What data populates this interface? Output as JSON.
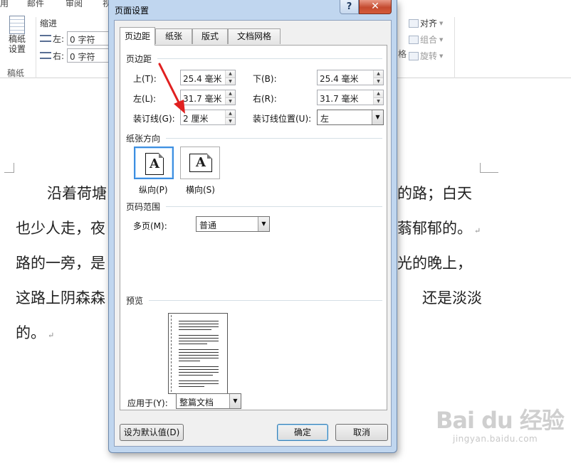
{
  "word": {
    "ribbon_tabs": [
      "用",
      "邮件",
      "审阅",
      "视"
    ],
    "paper_group": {
      "button_label_line1": "稿纸",
      "button_label_line2": "设置",
      "group_name": "稿纸"
    },
    "indent": {
      "title": "缩进",
      "left_label": "左:",
      "left_value": "0 字符",
      "right_label": "右:",
      "right_value": "0 字符"
    },
    "arrange": {
      "align": "对齐",
      "group": "组合",
      "rotate": "旋转",
      "fragment": "格"
    },
    "document_lines": [
      "沿着荷塘",
      "的路；白天",
      "也少人走，夜",
      "蓊郁郁的。",
      "路的一旁，是",
      "光的晚上，",
      "这路上阴森森",
      "还是淡淡",
      "的。"
    ],
    "paragraph_mark": "↵"
  },
  "watermark": {
    "logo": "Bai du 经验",
    "url": "jingyan.baidu.com"
  },
  "dialog": {
    "title": "页面设置",
    "help_label": "?",
    "close_label": "✕",
    "tabs": [
      {
        "label": "页边距",
        "active": true
      },
      {
        "label": "纸张",
        "active": false
      },
      {
        "label": "版式",
        "active": false
      },
      {
        "label": "文档网格",
        "active": false
      }
    ],
    "margins": {
      "group_title": "页边距",
      "top_label": "上(T):",
      "top_value": "25.4 毫米",
      "bottom_label": "下(B):",
      "bottom_value": "25.4 毫米",
      "left_label": "左(L):",
      "left_value": "31.7 毫米",
      "right_label": "右(R):",
      "right_value": "31.7 毫米",
      "gutter_label": "装订线(G):",
      "gutter_value": "2 厘米",
      "gutter_pos_label": "装订线位置(U):",
      "gutter_pos_value": "左"
    },
    "orientation": {
      "group_title": "纸张方向",
      "portrait_label": "纵向(P)",
      "landscape_label": "横向(S)",
      "glyph": "A",
      "selected": "portrait"
    },
    "pages": {
      "group_title": "页码范围",
      "multi_label": "多页(M):",
      "multi_value": "普通"
    },
    "preview": {
      "group_title": "预览"
    },
    "apply": {
      "label": "应用于(Y):",
      "value": "整篇文档"
    },
    "buttons": {
      "set_default": "设为默认值(D)",
      "ok": "确定",
      "cancel": "取消"
    }
  },
  "colors": {
    "annotation_arrow": "#e02020",
    "title_bar": "#c0d6ef",
    "close_button": "#c44a2f",
    "selection": "#3d8ee0"
  }
}
